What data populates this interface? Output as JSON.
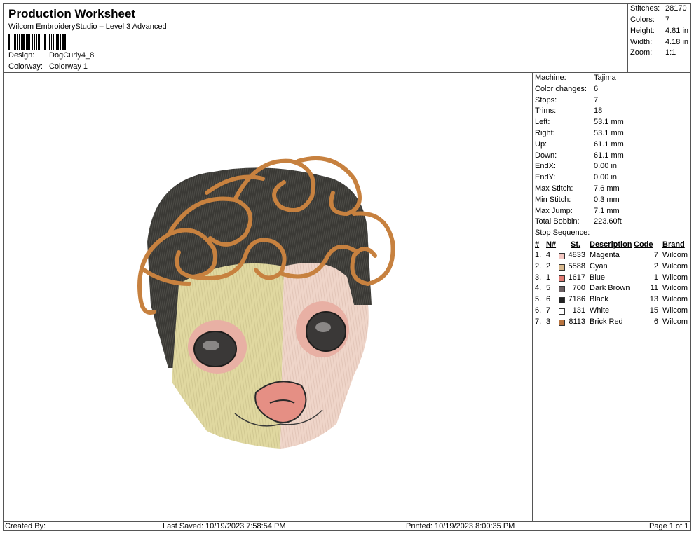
{
  "header": {
    "title": "Production Worksheet",
    "software": "Wilcom EmbroideryStudio – Level 3 Advanced",
    "design_label": "Design:",
    "design_value": "DogCurly4_8",
    "colorway_label": "Colorway:",
    "colorway_value": "Colorway 1"
  },
  "summary": [
    {
      "label": "Stitches:",
      "value": "28170"
    },
    {
      "label": "Colors:",
      "value": "7"
    },
    {
      "label": "Height:",
      "value": "4.81 in"
    },
    {
      "label": "Width:",
      "value": "4.18 in"
    },
    {
      "label": "Zoom:",
      "value": "1:1"
    }
  ],
  "machine_info": [
    {
      "label": "Machine:",
      "value": "Tajima"
    },
    {
      "label": "Color changes:",
      "value": "6"
    },
    {
      "label": "Stops:",
      "value": "7"
    },
    {
      "label": "Trims:",
      "value": "18"
    },
    {
      "label": "Left:",
      "value": "53.1 mm"
    },
    {
      "label": "Right:",
      "value": "53.1 mm"
    },
    {
      "label": "Up:",
      "value": "61.1 mm"
    },
    {
      "label": "Down:",
      "value": "61.1 mm"
    },
    {
      "label": "EndX:",
      "value": "0.00 in"
    },
    {
      "label": "EndY:",
      "value": "0.00 in"
    },
    {
      "label": "Max Stitch:",
      "value": "7.6 mm"
    },
    {
      "label": "Min Stitch:",
      "value": "0.3 mm"
    },
    {
      "label": "Max Jump:",
      "value": "7.1 mm"
    },
    {
      "label": "Total Bobbin:",
      "value": "223.60ft"
    }
  ],
  "stop_sequence": {
    "title": "Stop Sequence:",
    "columns": [
      "#",
      "N#",
      "St.",
      "Description",
      "Code",
      "Brand"
    ],
    "rows": [
      {
        "num": "1.",
        "n": "4",
        "color": "#f3c7c2",
        "st": "4833",
        "desc": "Magenta",
        "code": "7",
        "brand": "Wilcom"
      },
      {
        "num": "2.",
        "n": "2",
        "color": "#d8b98e",
        "st": "5588",
        "desc": "Cyan",
        "code": "2",
        "brand": "Wilcom"
      },
      {
        "num": "3.",
        "n": "1",
        "color": "#e07a72",
        "st": "1617",
        "desc": "Blue",
        "code": "1",
        "brand": "Wilcom"
      },
      {
        "num": "4.",
        "n": "5",
        "color": "#6a5f62",
        "st": "700",
        "desc": "Dark Brown",
        "code": "11",
        "brand": "Wilcom"
      },
      {
        "num": "5.",
        "n": "6",
        "color": "#222222",
        "st": "7186",
        "desc": "Black",
        "code": "13",
        "brand": "Wilcom"
      },
      {
        "num": "6.",
        "n": "7",
        "color": "#ffffff",
        "st": "131",
        "desc": "White",
        "code": "15",
        "brand": "Wilcom"
      },
      {
        "num": "7.",
        "n": "3",
        "color": "#b8733e",
        "st": "8113",
        "desc": "Brick Red",
        "code": "6",
        "brand": "Wilcom"
      }
    ]
  },
  "footer": {
    "created_by": "Created By:",
    "last_saved": "Last Saved: 10/19/2023 7:58:54 PM",
    "printed": "Printed: 10/19/2023 8:00:35 PM",
    "page": "Page 1 of 1"
  },
  "colors": {
    "face_left": "#e0d8a0",
    "face_right": "#efd5c9",
    "hair": "#3a3935",
    "curls": "#c7813f",
    "nose": "#e58f84",
    "eye": "#3a3837"
  }
}
